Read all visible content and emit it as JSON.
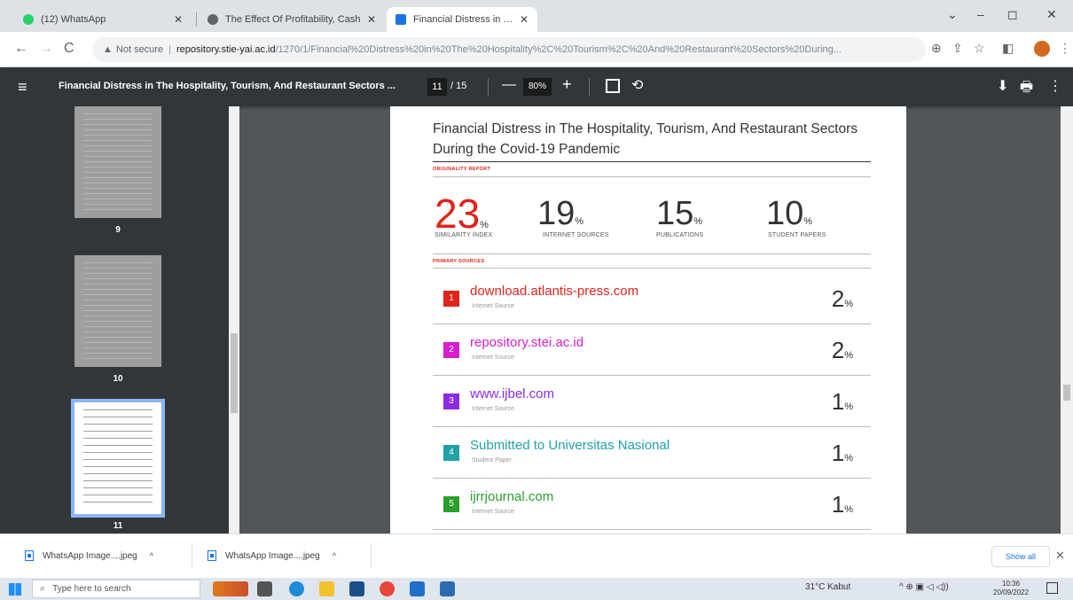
{
  "browser": {
    "tabs": [
      {
        "title": "(12) WhatsApp",
        "active": false,
        "favicon_color": "#25d366"
      },
      {
        "title": "The Effect Of Profitability, Cash",
        "active": false,
        "favicon_color": "#5f6368"
      },
      {
        "title": "Financial Distress in The Hospita",
        "active": true,
        "favicon_color": "#1a73e8"
      }
    ],
    "new_tab": "+",
    "window_controls": {
      "minimize": "–",
      "maximize": "◻",
      "close": "✕",
      "tab_search": "⌄"
    },
    "nav": {
      "back": "←",
      "forward": "→",
      "reload": "C"
    },
    "address": {
      "warning_icon": "▲",
      "not_secure": "Not secure",
      "host": "repository.stie-yai.ac.id",
      "path": "/1270/1/Financial%20Distress%20in%20The%20Hospitality%2C%20Tourism%2C%20And%20Restaurant%20Sectors%20During..."
    },
    "toolbar_icons": {
      "zoom": "⊕",
      "share": "⇪",
      "bookmark": "☆",
      "sidebar": "◧",
      "menu": "⋮"
    }
  },
  "pdf_viewer": {
    "menu": "≡",
    "title": "Financial Distress in The Hospitality, Tourism, And Restaurant Sectors ...",
    "current_page": "11",
    "total_pages": "/ 15",
    "zoom_out": "—",
    "zoom": "80%",
    "zoom_in": "+",
    "rotate": "⟲",
    "download": "⬇",
    "print": "🖶",
    "more": "⋮",
    "thumbnails": [
      {
        "label": "9",
        "active": false
      },
      {
        "label": "10",
        "active": false
      },
      {
        "label": "11",
        "active": true
      }
    ]
  },
  "report": {
    "title": "Financial Distress in The Hospitality, Tourism, And Restaurant Sectors During the Covid-19 Pandemic",
    "originality_label": "ORIGINALITY REPORT",
    "stats": [
      {
        "value": "23",
        "unit": "%",
        "label": "SIMILARITY INDEX"
      },
      {
        "value": "19",
        "unit": "%",
        "label": "INTERNET SOURCES"
      },
      {
        "value": "15",
        "unit": "%",
        "label": "PUBLICATIONS"
      },
      {
        "value": "10",
        "unit": "%",
        "label": "STUDENT PAPERS"
      }
    ],
    "primary_label": "PRIMARY SOURCES",
    "sources": [
      {
        "num": "1",
        "name": "download.atlantis-press.com",
        "type": "Internet Source",
        "pct": "2",
        "unit": "%",
        "color": "#e2231a"
      },
      {
        "num": "2",
        "name": "repository.stei.ac.id",
        "type": "Internet Source",
        "pct": "2",
        "unit": "%",
        "color": "#d61fcb"
      },
      {
        "num": "3",
        "name": "www.ijbel.com",
        "type": "Internet Source",
        "pct": "1",
        "unit": "%",
        "color": "#8a2be2"
      },
      {
        "num": "4",
        "name": "Submitted to Universitas Nasional",
        "type": "Student Paper",
        "pct": "1",
        "unit": "%",
        "color": "#21a0a8"
      },
      {
        "num": "5",
        "name": "ijrrjournal.com",
        "type": "Internet Source",
        "pct": "1",
        "unit": "%",
        "color": "#2ca02c"
      }
    ]
  },
  "downloads": {
    "items": [
      {
        "name": "WhatsApp Image....jpeg",
        "caret": "^"
      },
      {
        "name": "WhatsApp Image....jpeg",
        "caret": "^"
      }
    ],
    "show_all": "Show all",
    "close": "✕"
  },
  "taskbar": {
    "search_placeholder": "Type here to search",
    "search_icon": "⌕",
    "weather": "31°C  Kabut",
    "tray_icons": "^  ⊕  ▣  ◁  ◁))",
    "time": "10:36",
    "date": "20/09/2022"
  }
}
